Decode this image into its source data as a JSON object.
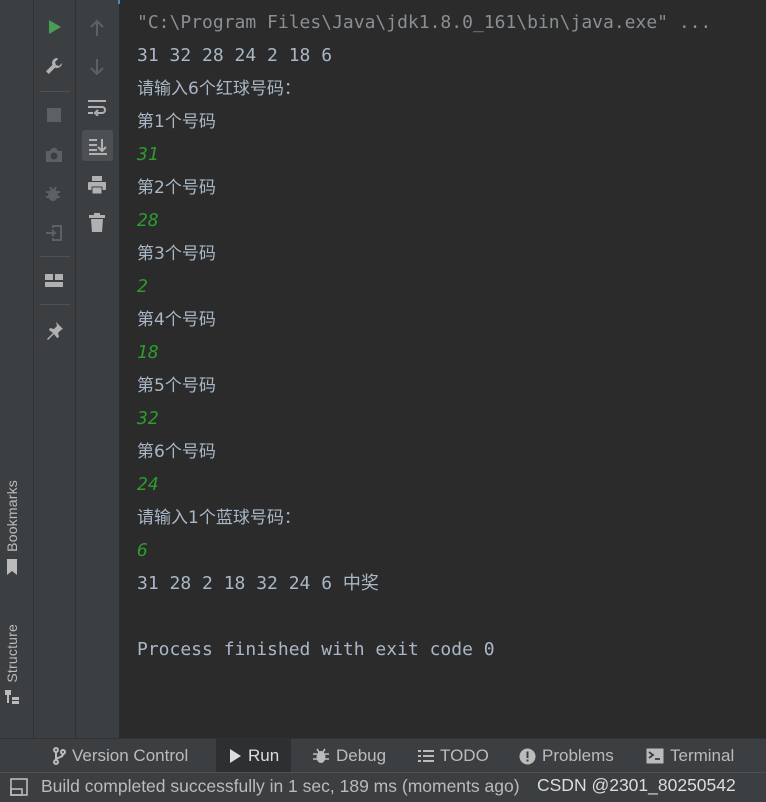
{
  "colors": {
    "console_bg": "#2b2b2b",
    "panel_bg": "#3c3f41",
    "output_text": "#a9b7c6",
    "user_input": "#2e9b2e",
    "run_green": "#499c54",
    "accent_blue": "#4a88c7"
  },
  "side_tabs": {
    "bookmarks": "Bookmarks",
    "structure": "Structure"
  },
  "toolbar_left": [
    {
      "icon": "run-icon",
      "enabled": true
    },
    {
      "icon": "wrench-icon",
      "enabled": true
    },
    {
      "icon": "stop-icon",
      "enabled": false
    },
    {
      "icon": "camera-icon",
      "enabled": false
    },
    {
      "icon": "debug-bug-icon",
      "enabled": false
    },
    {
      "icon": "exit-icon",
      "enabled": false
    },
    {
      "icon": "layout-icon",
      "enabled": true
    },
    {
      "icon": "pin-icon",
      "enabled": true
    }
  ],
  "toolbar_right": [
    {
      "icon": "arrow-up-icon",
      "enabled": false
    },
    {
      "icon": "arrow-down-icon",
      "enabled": false
    },
    {
      "icon": "soft-wrap-icon",
      "enabled": true
    },
    {
      "icon": "scroll-to-end-icon",
      "enabled": true,
      "active": true
    },
    {
      "icon": "print-icon",
      "enabled": true
    },
    {
      "icon": "trash-icon",
      "enabled": true
    }
  ],
  "console": {
    "lines": [
      {
        "text": "\"C:\\Program Files\\Java\\jdk1.8.0_161\\bin\\java.exe\" ...",
        "kind": "command"
      },
      {
        "text": "31 32 28 24 2 18 6",
        "kind": "output"
      },
      {
        "text": "请输入6个红球号码：",
        "kind": "output"
      },
      {
        "text": "第1个号码",
        "kind": "output"
      },
      {
        "text": "31",
        "kind": "input"
      },
      {
        "text": "第2个号码",
        "kind": "output"
      },
      {
        "text": "28",
        "kind": "input"
      },
      {
        "text": "第3个号码",
        "kind": "output"
      },
      {
        "text": "2",
        "kind": "input"
      },
      {
        "text": "第4个号码",
        "kind": "output"
      },
      {
        "text": "18",
        "kind": "input"
      },
      {
        "text": "第5个号码",
        "kind": "output"
      },
      {
        "text": "32",
        "kind": "input"
      },
      {
        "text": "第6个号码",
        "kind": "output"
      },
      {
        "text": "24",
        "kind": "input"
      },
      {
        "text": "请输入1个蓝球号码：",
        "kind": "output"
      },
      {
        "text": "6",
        "kind": "input"
      },
      {
        "text": "31 28 2 18 32 24 6 中奖",
        "kind": "output"
      },
      {
        "text": "",
        "kind": "blank"
      },
      {
        "text": "Process finished with exit code 0",
        "kind": "output"
      }
    ]
  },
  "tool_tabs": [
    {
      "label": "Version Control",
      "icon": "branch-icon",
      "active": false
    },
    {
      "label": "Run",
      "icon": "run-tab-icon",
      "active": true
    },
    {
      "label": "Debug",
      "icon": "bug-icon",
      "active": false
    },
    {
      "label": "TODO",
      "icon": "list-icon",
      "active": false
    },
    {
      "label": "Problems",
      "icon": "warning-icon",
      "active": false
    },
    {
      "label": "Terminal",
      "icon": "terminal-icon",
      "active": false
    }
  ],
  "status_bar": {
    "message": "Build completed successfully in 1 sec, 189 ms (moments ago)",
    "watermark": "CSDN @2301_80250542"
  }
}
